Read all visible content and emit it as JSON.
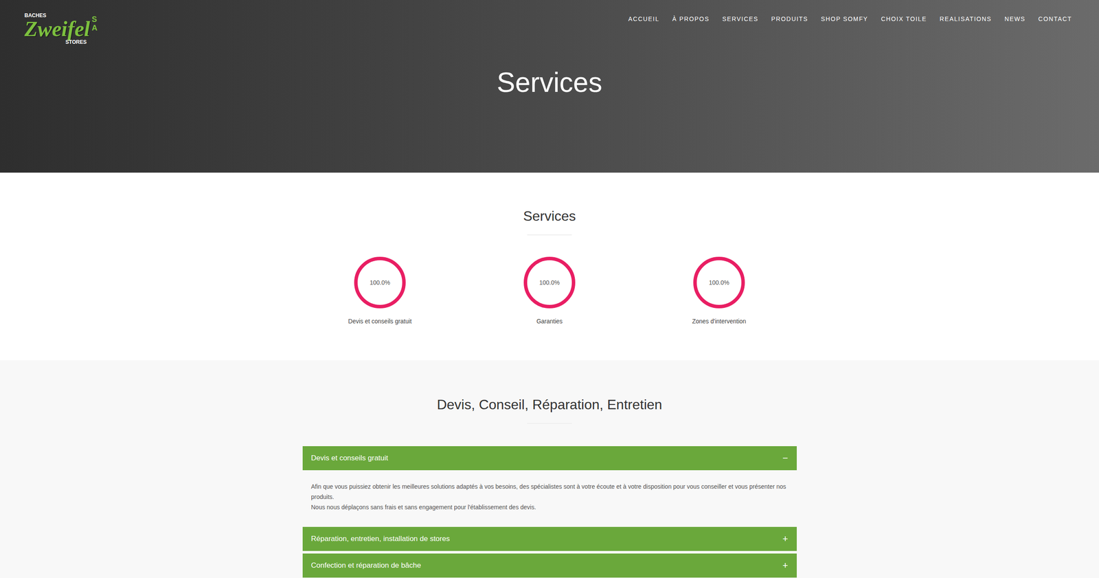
{
  "logo": {
    "top": "BACHES",
    "name": "Zweifel",
    "suffix": "SA",
    "bottom": "STORES"
  },
  "nav": [
    "ACCUEIL",
    "À PROPOS",
    "SERVICES",
    "PRODUITS",
    "SHOP SOMFY",
    "CHOIX TOILE",
    "REALISATIONS",
    "NEWS",
    "CONTACT"
  ],
  "hero": {
    "title": "Services"
  },
  "stats_section": {
    "title": "Services",
    "stats": [
      {
        "label": "Devis et conseils gratuit",
        "reading": "100.0%",
        "level": 1
      },
      {
        "label": "Garanties",
        "reading": "100.0%",
        "level": 1
      },
      {
        "label": "Zones d'intervention",
        "reading": "100.0%",
        "level": 1
      }
    ]
  },
  "accordion_section": {
    "title": "Devis, Conseil, Réparation, Entretien",
    "items": [
      {
        "title": "Devis et conseils gratuit",
        "expanded": true,
        "icon": "−",
        "body": [
          "Afin que vous puissiez obtenir les meilleures solutions adaptés à vos besoins, des spécialistes sont à votre écoute et à votre disposition pour vous conseiller et vous présenter nos produits.",
          "Nous nous déplaçons sans frais et sans engagement pour l'établissement des devis."
        ]
      },
      {
        "title": "Réparation, entretien, installation de stores",
        "expanded": false,
        "icon": "+",
        "body": []
      },
      {
        "title": "Confection et réparation de bâche",
        "expanded": false,
        "icon": "+",
        "body": []
      },
      {
        "title": "",
        "expanded": false,
        "icon": "",
        "body": []
      }
    ]
  }
}
